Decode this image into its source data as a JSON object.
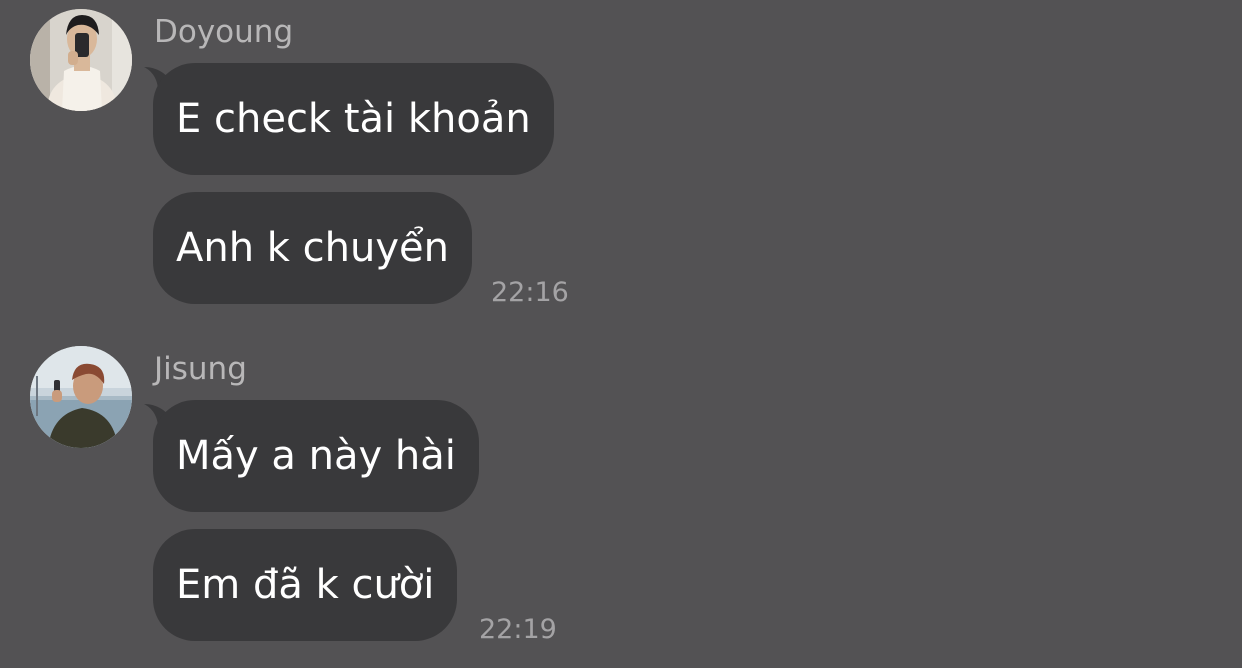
{
  "conversation": {
    "groups": [
      {
        "sender": "Doyoung",
        "avatar_icon": "profile-photo",
        "messages": [
          "E check tài khoản",
          "Anh k chuyển"
        ],
        "time": "22:16"
      },
      {
        "sender": "Jisung",
        "avatar_icon": "profile-photo",
        "messages": [
          "Mấy a này hài",
          "Em đã k cười"
        ],
        "time": "22:19"
      }
    ]
  },
  "colors": {
    "background": "#535254",
    "bubble": "#39393b",
    "message_text": "#ffffff",
    "sender_text": "#b8b7b8",
    "time_text": "#a4a3a5"
  }
}
